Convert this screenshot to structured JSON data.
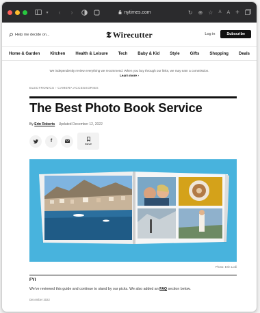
{
  "browser": {
    "url": "nytimes.com",
    "traffic_colors": [
      "#ff5f57",
      "#febc2e",
      "#28c840"
    ]
  },
  "header": {
    "help_text": "Help me decide on...",
    "logo_mark": "𝕿",
    "logo_text": "Wirecutter",
    "login_label": "Log in",
    "subscribe_label": "Subscribe"
  },
  "nav": {
    "items": [
      "Home & Garden",
      "Kitchen",
      "Health & Leisure",
      "Tech",
      "Baby & Kid",
      "Style",
      "Gifts",
      "Shopping",
      "Deals"
    ]
  },
  "disclaimer": {
    "text": "We independently review everything we recommend. When you buy through our links, we may earn a commission.",
    "more": "Learn more ›"
  },
  "article": {
    "breadcrumb": "ELECTRONICS › CAMERA ACCESSORIES",
    "title": "The Best Photo Book Service",
    "by": "By",
    "author": "Erin Roberts",
    "updated": "Updated December 12, 2022",
    "save_label": "Save",
    "photo_credit": "Photo: Erin Lodi",
    "fyi_heading": "FYI",
    "fyi_text_before": "We've reviewed this guide and continue to stand by our picks. We also added an ",
    "fyi_link": "FAQ",
    "fyi_text_after": " section below.",
    "fyi_date": "December 2022"
  },
  "colors": {
    "hero_background": "#48b3dd",
    "subscribe_background": "#121212"
  }
}
